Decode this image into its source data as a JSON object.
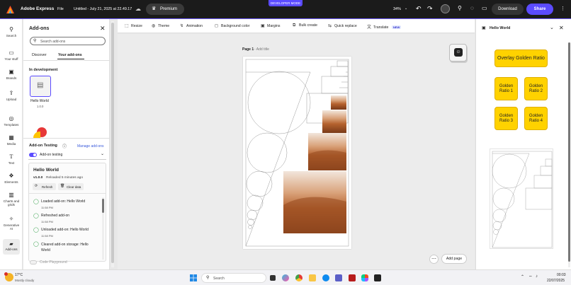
{
  "app": {
    "name": "Adobe Express",
    "file_menu": "File",
    "doc_title": "Untitled - July 21, 2025 at 22.49.17",
    "premium": "Premium",
    "dev_mode": "DEVELOPER MODE",
    "zoom": "34%",
    "download": "Download",
    "share": "Share"
  },
  "rail": {
    "items": [
      "Search",
      "Your stuff",
      "Brands",
      "Upload",
      "Templates",
      "Media",
      "Text",
      "Elements",
      "Charts and grids",
      "Generative AI",
      "Add-ons"
    ]
  },
  "panel": {
    "title": "Add-ons",
    "search_placeholder": "Search add-ons",
    "tabs": [
      "Discover",
      "Your add-ons"
    ],
    "in_dev": "In development",
    "addon_name": "Hello World",
    "addon_version": "1.0.0",
    "testing_title": "Add-on Testing",
    "manage": "Manage add-ons",
    "testing_toggle": "Add-on testing",
    "card_title": "Hello World",
    "card_version": "v1.0.0",
    "card_reloaded": "Reloaded 5 minutes ago",
    "refresh": "Refresh",
    "clear": "Clear data",
    "logs": [
      {
        "text": "Loaded add-on: Hello World",
        "time": "11:58 PM"
      },
      {
        "text": "Refreshed add-on",
        "time": "11:58 PM"
      },
      {
        "text": "Unloaded add-on: Hello World",
        "time": "11:58 PM"
      },
      {
        "text": "Cleared add-on storage: Hello World",
        "time": ""
      }
    ],
    "code_playground": "Code Playground"
  },
  "toolbar": {
    "items": [
      "Resize",
      "Theme",
      "Animation",
      "Background color",
      "Margins",
      "Bulk create",
      "Quick replace",
      "Translate"
    ],
    "new_badge": "NEW"
  },
  "canvas": {
    "page_label": "Page 1",
    "add_title": "- Add title",
    "add_page": "Add page"
  },
  "rpanel": {
    "title": "Hello World",
    "overlay_btn": "Overlay Golden Ratio",
    "golden_btns": [
      "Golden Ratio 1",
      "Golden Ratio 2",
      "Golden Ratio 3",
      "Golden Ratio 4"
    ]
  },
  "taskbar": {
    "weather_temp": "17°C",
    "weather_desc": "Mostly cloudy",
    "search": "Search",
    "time": "00:03",
    "date": "22/07/2025"
  },
  "colors": {
    "accent": "#5b4bff",
    "yellow": "#ffd200",
    "dark": "#1b1b1b"
  }
}
